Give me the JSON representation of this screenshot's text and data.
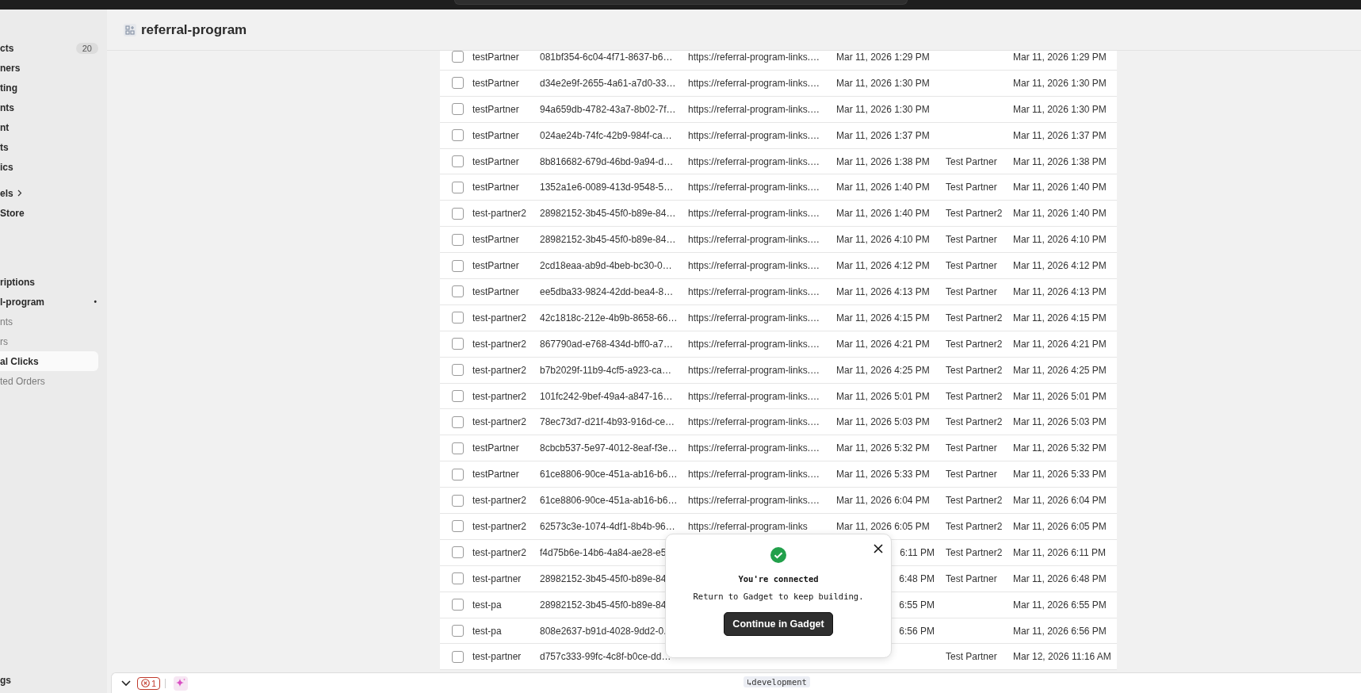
{
  "sidebar": {
    "items": [
      {
        "label": "cts",
        "count": "20",
        "muted": false,
        "selected": false
      },
      {
        "label": "ners",
        "muted": false,
        "selected": false
      },
      {
        "label": "ting",
        "muted": false,
        "selected": false
      },
      {
        "label": "nts",
        "muted": false,
        "selected": false
      },
      {
        "label": "nt",
        "muted": false,
        "selected": false
      },
      {
        "label": "ts",
        "muted": false,
        "selected": false
      },
      {
        "label": "ics",
        "muted": false,
        "selected": false
      },
      {
        "label": "els",
        "expandable": true,
        "muted": false,
        "selected": false
      },
      {
        "label": "Store",
        "muted": false,
        "selected": false
      },
      {
        "label": "riptions",
        "muted": false,
        "selected": false
      },
      {
        "label": "l-program",
        "marker": "•",
        "muted": false,
        "selected": false
      },
      {
        "label": "nts",
        "muted": true,
        "selected": false
      },
      {
        "label": "rs",
        "muted": true,
        "selected": false
      },
      {
        "label": "al Clicks",
        "muted": false,
        "selected": true
      },
      {
        "label": "ted Orders",
        "muted": true,
        "selected": false
      }
    ],
    "footer": "gs"
  },
  "header": {
    "title": "referral-program"
  },
  "table": {
    "rows": [
      {
        "name": "testPartner",
        "id": "081bf354-6c04-4f71-8637-b6…",
        "link": "https://referral-program-links.…",
        "created": "Mar 11, 2026 1:29 PM",
        "updated": "Mar 11, 2026 1:29 PM",
        "checked": false
      },
      {
        "name": "testPartner",
        "id": "d34e2e9f-2655-4a61-a7d0-33…",
        "link": "https://referral-program-links.…",
        "created": "Mar 11, 2026 1:30 PM",
        "updated": "Mar 11, 2026 1:30 PM",
        "checked": false
      },
      {
        "name": "testPartner",
        "id": "94a659db-4782-43a7-8b02-7f…",
        "link": "https://referral-program-links.…",
        "created": "Mar 11, 2026 1:30 PM",
        "updated": "Mar 11, 2026 1:30 PM",
        "checked": false
      },
      {
        "name": "testPartner",
        "id": "024ae24b-74fc-42b9-984f-ca…",
        "link": "https://referral-program-links.…",
        "created": "Mar 11, 2026 1:37 PM",
        "updated": "Mar 11, 2026 1:37 PM",
        "checked": false
      },
      {
        "name": "testPartner",
        "id": "8b816682-679d-46bd-9a94-d…",
        "link": "https://referral-program-links.…",
        "created": "Mar 11, 2026 1:38 PM",
        "partner": "Test Partner",
        "updated": "Mar 11, 2026 1:38 PM",
        "checked": false
      },
      {
        "name": "testPartner",
        "id": "1352a1e6-0089-413d-9548-5…",
        "link": "https://referral-program-links.…",
        "created": "Mar 11, 2026 1:40 PM",
        "partner": "Test Partner",
        "updated": "Mar 11, 2026 1:40 PM",
        "checked": false
      },
      {
        "name": "test-partner2",
        "id": "28982152-3b45-45f0-b89e-84…",
        "link": "https://referral-program-links.…",
        "created": "Mar 11, 2026 1:40 PM",
        "partner": "Test Partner2",
        "updated": "Mar 11, 2026 1:40 PM",
        "checked": false
      },
      {
        "name": "testPartner",
        "id": "28982152-3b45-45f0-b89e-84…",
        "link": "https://referral-program-links.…",
        "created": "Mar 11, 2026 4:10 PM",
        "partner": "Test Partner",
        "updated": "Mar 11, 2026 4:10 PM",
        "checked": false
      },
      {
        "name": "testPartner",
        "id": "2cd18eaa-ab9d-4beb-bc30-0…",
        "link": "https://referral-program-links.…",
        "created": "Mar 11, 2026 4:12 PM",
        "partner": "Test Partner",
        "updated": "Mar 11, 2026 4:12 PM",
        "checked": false
      },
      {
        "name": "testPartner",
        "id": "ee5dba33-9824-42dd-bea4-8…",
        "link": "https://referral-program-links.…",
        "created": "Mar 11, 2026 4:13 PM",
        "partner": "Test Partner",
        "updated": "Mar 11, 2026 4:13 PM",
        "checked": false
      },
      {
        "name": "test-partner2",
        "id": "42c1818c-212e-4b9b-8658-66…",
        "link": "https://referral-program-links.…",
        "created": "Mar 11, 2026 4:15 PM",
        "partner": "Test Partner2",
        "updated": "Mar 11, 2026 4:15 PM",
        "checked": false
      },
      {
        "name": "test-partner2",
        "id": "867790ad-e768-434d-bff0-a7…",
        "link": "https://referral-program-links.…",
        "created": "Mar 11, 2026 4:21 PM",
        "partner": "Test Partner2",
        "updated": "Mar 11, 2026 4:21 PM",
        "checked": false
      },
      {
        "name": "test-partner2",
        "id": "b7b2029f-11b9-4cf5-a923-ca…",
        "link": "https://referral-program-links.…",
        "created": "Mar 11, 2026 4:25 PM",
        "partner": "Test Partner2",
        "updated": "Mar 11, 2026 4:25 PM",
        "checked": false
      },
      {
        "name": "test-partner2",
        "id": "101fc242-9bef-49a4-a847-16…",
        "link": "https://referral-program-links.…",
        "created": "Mar 11, 2026 5:01 PM",
        "partner": "Test Partner2",
        "updated": "Mar 11, 2026 5:01 PM",
        "checked": false
      },
      {
        "name": "test-partner2",
        "id": "78ec73d7-d21f-4b93-916d-ce…",
        "link": "https://referral-program-links.…",
        "created": "Mar 11, 2026 5:03 PM",
        "partner": "Test Partner2",
        "updated": "Mar 11, 2026 5:03 PM",
        "checked": false
      },
      {
        "name": "testPartner",
        "id": "8cbcb537-5e97-4012-8eaf-f3e…",
        "link": "https://referral-program-links.…",
        "created": "Mar 11, 2026 5:32 PM",
        "partner": "Test Partner",
        "updated": "Mar 11, 2026 5:32 PM",
        "checked": false
      },
      {
        "name": "testPartner",
        "id": "61ce8806-90ce-451a-ab16-b6…",
        "link": "https://referral-program-links.…",
        "created": "Mar 11, 2026 5:33 PM",
        "partner": "Test Partner",
        "updated": "Mar 11, 2026 5:33 PM",
        "checked": false
      },
      {
        "name": "test-partner2",
        "id": "61ce8806-90ce-451a-ab16-b6…",
        "link": "https://referral-program-links.…",
        "created": "Mar 11, 2026 6:04 PM",
        "partner": "Test Partner2",
        "updated": "Mar 11, 2026 6:04 PM",
        "checked": false
      },
      {
        "name": "test-partner2",
        "id": "62573c3e-1074-4df1-8b4b-96…",
        "link": "https://referral-program-links",
        "created": "Mar 11, 2026 6:05 PM",
        "partner": "Test Partner2",
        "updated": "Mar 11, 2026 6:05 PM",
        "checked": false
      },
      {
        "name": "test-partner2",
        "id": "f4d75b6e-14b6-4a84-ae28-e5",
        "created": "6:11 PM",
        "partner": "Test Partner2",
        "updated": "Mar 11, 2026 6:11 PM",
        "checked": false,
        "covered": true
      },
      {
        "name": "test-partner",
        "id": "28982152-3b45-45f0-b89e-84",
        "created": "6:48 PM",
        "partner": "Test Partner",
        "updated": "Mar 11, 2026 6:48 PM",
        "checked": false,
        "covered": true
      },
      {
        "name": "test-pa",
        "id": "28982152-3b45-45f0-b89e-84",
        "created": "6:55 PM",
        "updated": "Mar 11, 2026 6:55 PM",
        "checked": false,
        "covered": true
      },
      {
        "name": "test-pa",
        "id": "808e2637-b91d-4028-9dd2-0.",
        "created": "6:56 PM",
        "updated": "Mar 11, 2026 6:56 PM",
        "checked": false,
        "covered": true
      },
      {
        "name": "test-partner",
        "id": "d757c333-99fc-4c8f-b0ce-dd…",
        "partner": "Test Partner",
        "updated": "Mar 12, 2026 11:16 AM",
        "checked": false
      }
    ]
  },
  "dialog": {
    "title": "You're connected",
    "message": "Return to Gadget to keep building.",
    "button": "Continue in Gadget"
  },
  "status_bar": {
    "error_count": "1",
    "branch": "↳development"
  }
}
